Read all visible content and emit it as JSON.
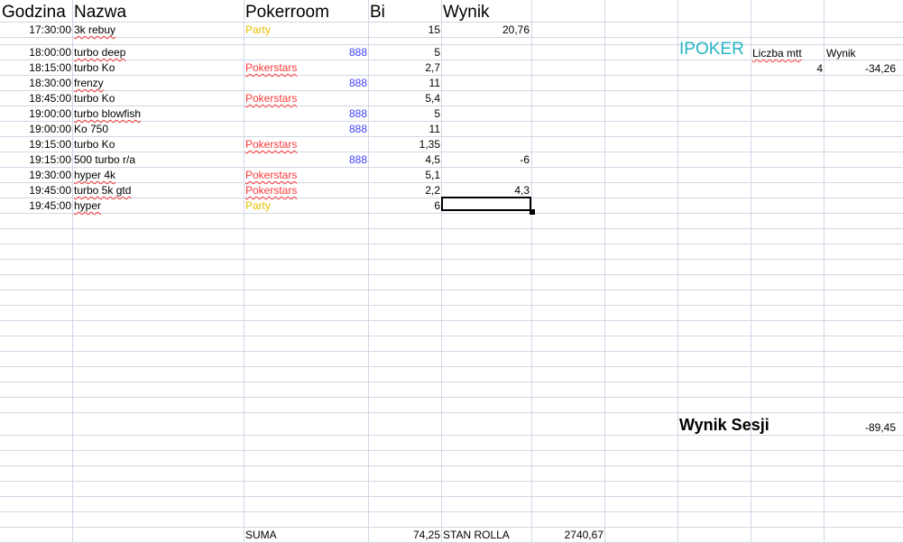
{
  "headers": {
    "godzina": "Godzina",
    "nazwa": "Nazwa",
    "pokerroom": "Pokerroom",
    "bi": "Bi",
    "wynik": "Wynik"
  },
  "rows": [
    {
      "time": "17:30:00",
      "name": "3k rebuy",
      "room": "Party",
      "bi": "15",
      "wynik": "20,76"
    },
    {
      "time": "18:00:00",
      "name": "turbo deep",
      "room": "888",
      "bi": "5",
      "wynik": ""
    },
    {
      "time": "18:15:00",
      "name": "turbo Ko",
      "room": "Pokerstars",
      "bi": "2,7",
      "wynik": ""
    },
    {
      "time": "18:30:00",
      "name": "frenzy",
      "room": "888",
      "bi": "11",
      "wynik": ""
    },
    {
      "time": "18:45:00",
      "name": "turbo Ko",
      "room": "Pokerstars",
      "bi": "5,4",
      "wynik": ""
    },
    {
      "time": "19:00:00",
      "name": "turbo blowfish",
      "room": "888",
      "bi": "5",
      "wynik": ""
    },
    {
      "time": "19:00:00",
      "name": "Ko 750",
      "room": "888",
      "bi": "11",
      "wynik": ""
    },
    {
      "time": "19:15:00",
      "name": "turbo Ko",
      "room": "Pokerstars",
      "bi": "1,35",
      "wynik": ""
    },
    {
      "time": "19:15:00",
      "name": "500 turbo r/a",
      "room": "888",
      "bi": "4,5",
      "wynik": "-6"
    },
    {
      "time": "19:30:00",
      "name": "hyper 4k",
      "room": "Pokerstars",
      "bi": "5,1",
      "wynik": ""
    },
    {
      "time": "19:45:00",
      "name": "turbo 5k gtd",
      "room": "Pokerstars",
      "bi": "2,2",
      "wynik": "4,3"
    },
    {
      "time": "19:45:00",
      "name": "hyper",
      "room": "Party",
      "bi": "6",
      "wynik": ""
    }
  ],
  "ipoker": {
    "title": "IPOKER",
    "liczba_mtt_label": "Liczba mtt",
    "wynik_label": "Wynik",
    "liczba_mtt": "4",
    "wynik": "-34,26"
  },
  "session": {
    "label": "Wynik Sesji",
    "value": "-89,45"
  },
  "footer": {
    "suma_label": "SUMA",
    "suma_value": "74,25",
    "stan_label": "STAN ROLLA",
    "stan_value": "2740,67"
  },
  "colors": {
    "party": "#e6c200",
    "pokerstars": "#ff3a3a",
    "n888": "#3f3fff",
    "ipoker": "#27b6c6",
    "grid": "#d0d7e5"
  }
}
